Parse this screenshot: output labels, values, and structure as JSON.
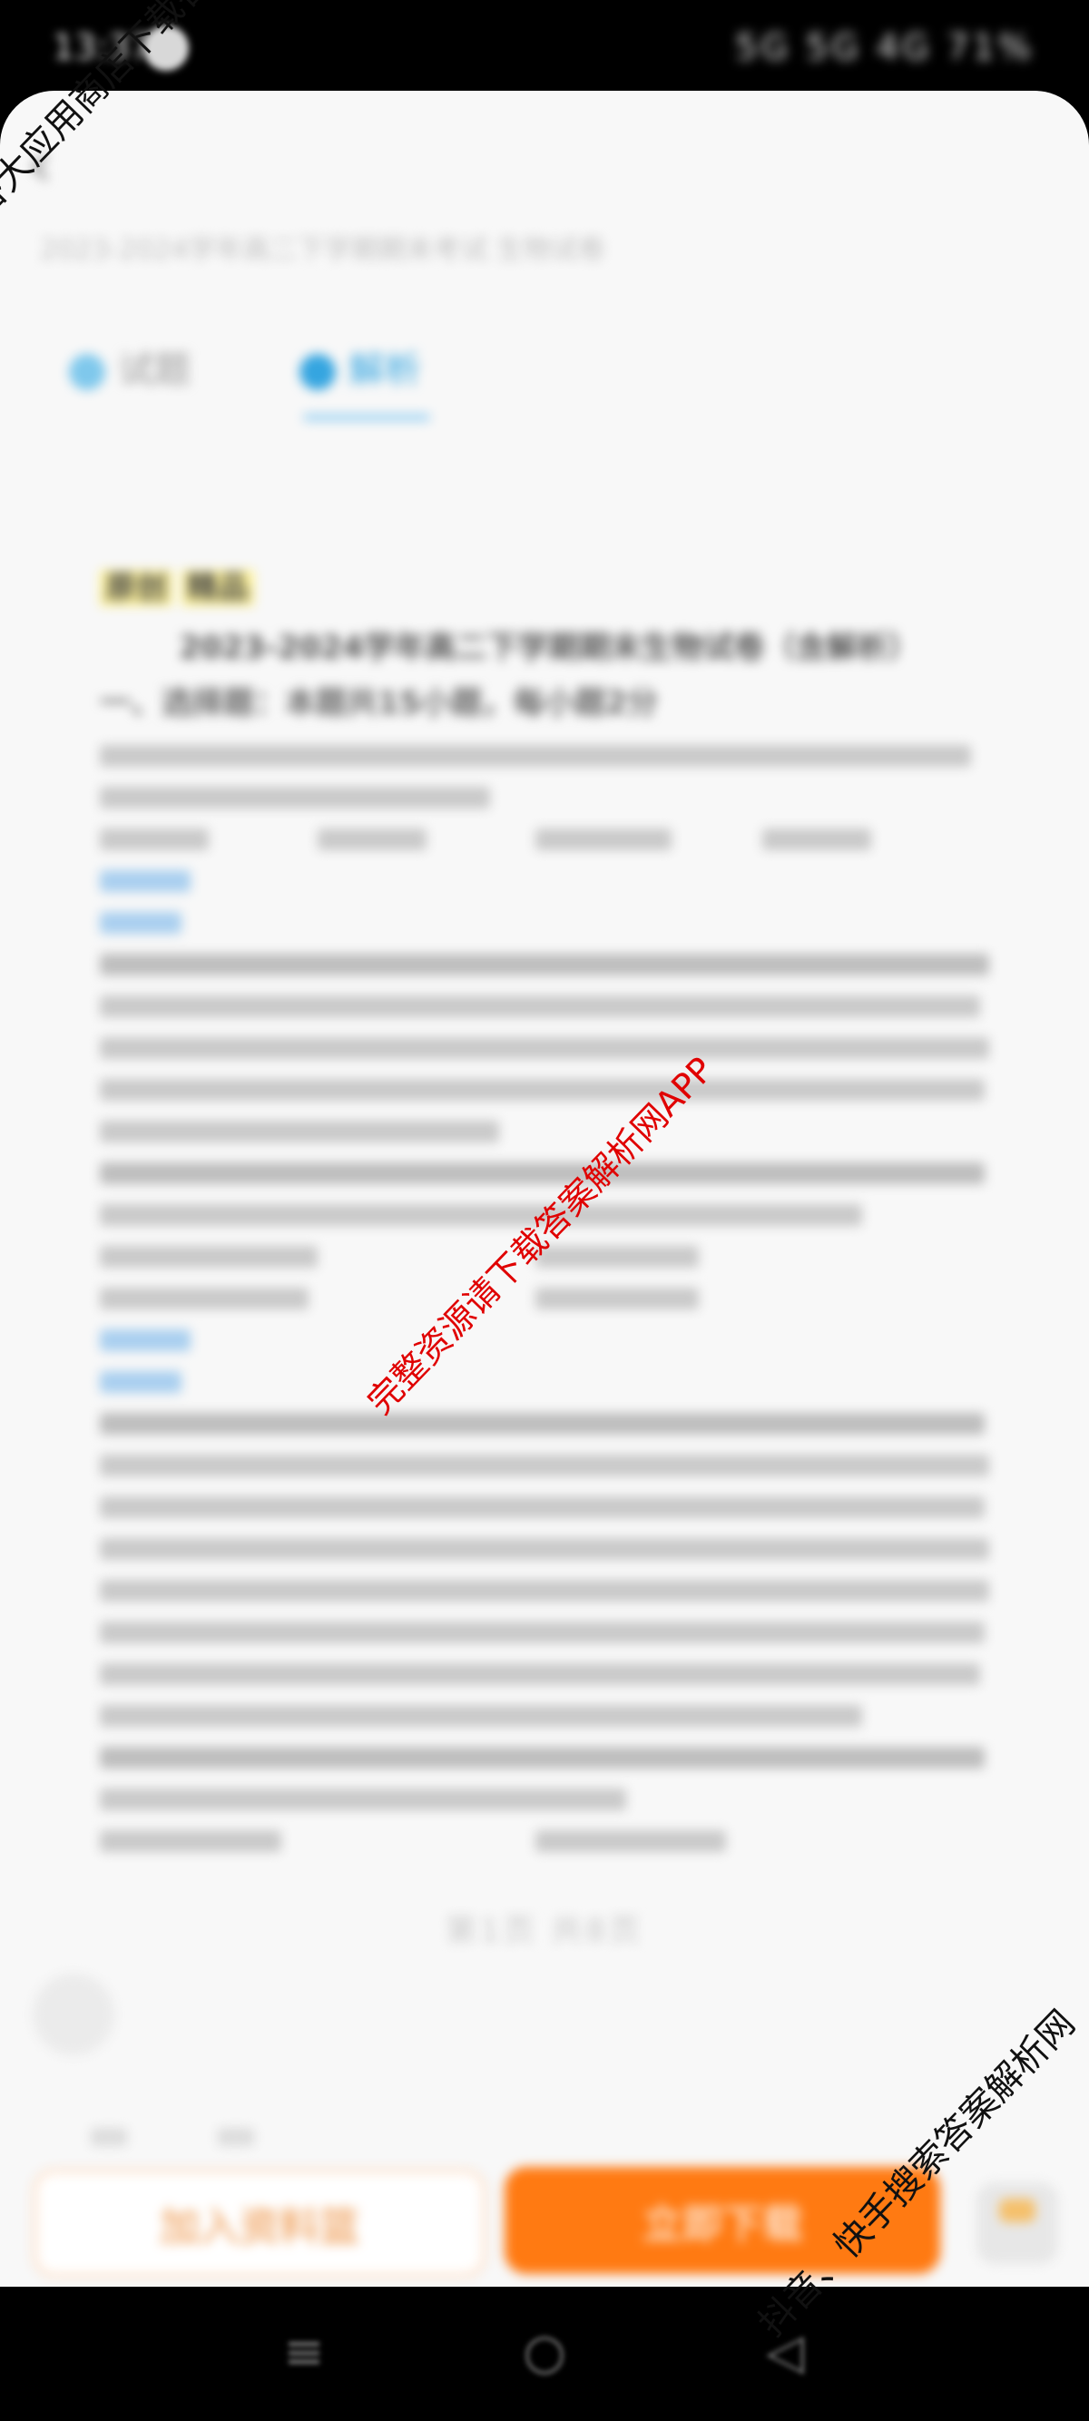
{
  "status_bar": {
    "time": "13:37",
    "indicators": "5G 5G 4G 71%"
  },
  "header": {
    "back_icon": "chevron-left-icon",
    "breadcrumb": "2023-2024学年高二下学期期末考试 生物试卷"
  },
  "tabs": [
    {
      "label": "试题",
      "icon": "dot-icon"
    },
    {
      "label": "解析",
      "icon": "dot-icon",
      "active": true
    }
  ],
  "document": {
    "badges": [
      "原创",
      "精品"
    ],
    "title": "2023-2024学年高二下学期期末生物试卷（含解析）",
    "section": "一、选择题：本题共15小题，每小题2分",
    "answer_label_1": "【答案】",
    "analysis_label_1": "【解析】",
    "answer_label_2": "【答案】",
    "analysis_label_2": "【解析】",
    "footer_text": "第1页 共8页"
  },
  "watermarks": {
    "top_left": "各大应用商店下载答案解析网",
    "center": "完整资源请下载答案解析网APP",
    "bottom_right": "抖音、快手搜索答案解析网"
  },
  "actions": {
    "secondary_label": "加入资料篮",
    "primary_label": "立即下载",
    "side_icon": "basket-icon"
  },
  "navbar": {
    "menu_icon": "menu-icon",
    "home_icon": "home-circle-icon",
    "back_icon": "back-triangle-icon"
  },
  "colors": {
    "accent_blue": "#35a5e0",
    "primary_orange": "#ff7a12",
    "watermark_red": "#e00000",
    "sheet_bg": "#f8f8f8"
  }
}
